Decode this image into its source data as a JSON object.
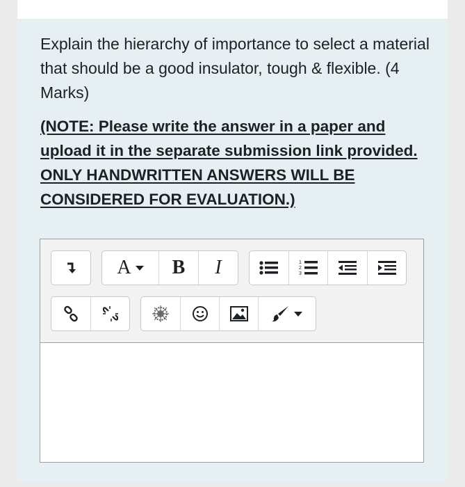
{
  "question": {
    "text": "Explain the hierarchy of importance to select a material that should be a good insulator, tough & flexible. (4 Marks)",
    "note": "(NOTE: Please write the answer in a paper and upload it in the separate submission link provided. ONLY HANDWRITTEN ANSWERS WILL BE CONSIDERED FOR EVALUATION.)"
  },
  "toolbar": {
    "font_label": "A",
    "bold_label": "B",
    "italic_label": "I",
    "icons": [
      "collapse-icon",
      "font-color-icon",
      "bold-icon",
      "italic-icon",
      "unordered-list-icon",
      "ordered-list-icon",
      "outdent-icon",
      "indent-icon",
      "link-icon",
      "unlink-icon",
      "media-icon",
      "emoji-icon",
      "image-icon",
      "brush-icon"
    ]
  },
  "editor": {
    "content": ""
  }
}
